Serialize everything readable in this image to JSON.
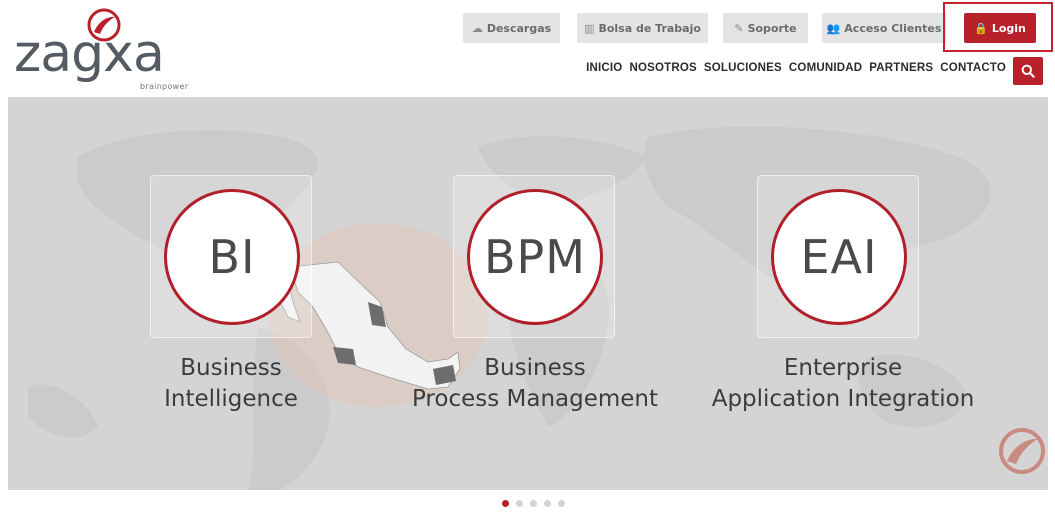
{
  "brand": {
    "name": "zagxa",
    "tagline": "brainpower",
    "accent_color": "#b8202a",
    "logo_icon": "zagxa-swoosh-icon"
  },
  "topbar": {
    "buttons": [
      {
        "label": "Descargas",
        "icon": "cloud-icon"
      },
      {
        "label": "Bolsa de Trabajo",
        "icon": "briefcase-icon"
      },
      {
        "label": "Soporte",
        "icon": "wrench-icon"
      },
      {
        "label": "Acceso Clientes",
        "icon": "users-icon"
      }
    ],
    "login": {
      "label": "Login",
      "icon": "lock-icon"
    }
  },
  "nav": {
    "items": [
      "INICIO",
      "NOSOTROS",
      "SOLUCIONES",
      "COMUNIDAD",
      "PARTNERS",
      "CONTACTO"
    ],
    "search_icon": "search-icon"
  },
  "hero": {
    "cards": [
      {
        "abbr": "BI",
        "line1": "Business",
        "line2": "Intelligence"
      },
      {
        "abbr": "BPM",
        "line1": "Business",
        "line2": "Process Management"
      },
      {
        "abbr": "EAI",
        "line1": "Enterprise",
        "line2": "Application Integration"
      }
    ]
  },
  "carousel": {
    "slide_count": 5,
    "active_index": 0
  }
}
